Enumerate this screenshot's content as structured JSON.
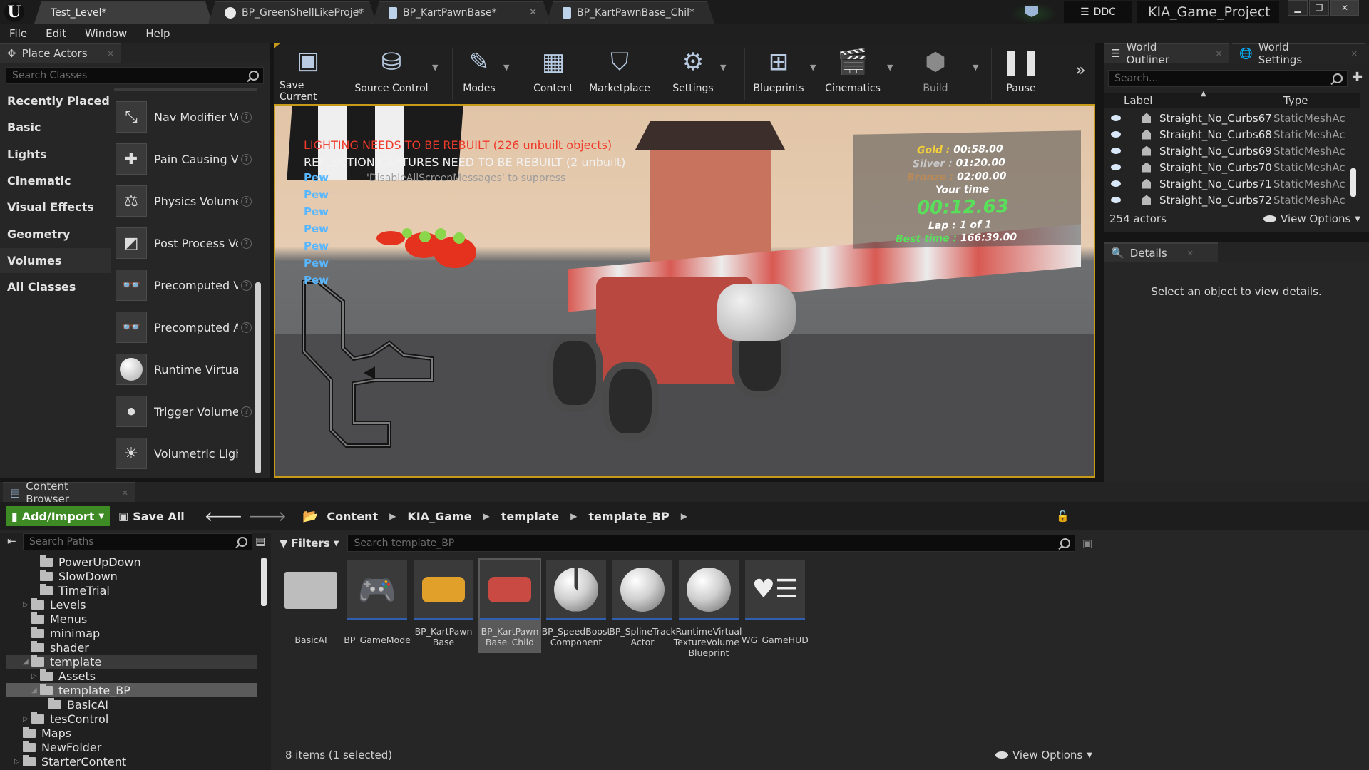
{
  "titlebar": {
    "tabs": [
      {
        "label": "Test_Level*"
      },
      {
        "label": "BP_GreenShellLikeProje*"
      },
      {
        "label": "BP_KartPawnBase*"
      },
      {
        "label": "BP_KartPawnBase_Chil*"
      }
    ],
    "ddc_label": "DDC",
    "project_name": "KIA_Game_Project"
  },
  "menubar": {
    "items": [
      "File",
      "Edit",
      "Window",
      "Help"
    ]
  },
  "place_actors": {
    "title": "Place Actors",
    "search_placeholder": "Search Classes",
    "categories": [
      "Recently Placed",
      "Basic",
      "Lights",
      "Cinematic",
      "Visual Effects",
      "Geometry",
      "Volumes",
      "All Classes"
    ],
    "selected_category": "Volumes",
    "items": [
      {
        "label": "Nav Modifier Volume",
        "icon": "nav-modifier-icon"
      },
      {
        "label": "Pain Causing Volume",
        "icon": "pain-causing-icon"
      },
      {
        "label": "Physics Volume",
        "icon": "physics-volume-icon"
      },
      {
        "label": "Post Process Volume",
        "icon": "post-process-icon"
      },
      {
        "label": "Precomputed Visibility Volume",
        "icon": "precomputed-icon"
      },
      {
        "label": "Precomputed AI",
        "icon": "precomputed-icon"
      },
      {
        "label": "Runtime Virtual Texture",
        "icon": "sphere-icon"
      },
      {
        "label": "Trigger Volume",
        "icon": "trigger-icon"
      },
      {
        "label": "Volumetric Lightmap",
        "icon": "sun-icon"
      }
    ]
  },
  "toolbar": {
    "buttons": [
      {
        "label": "Save Current",
        "icon": "save-icon"
      },
      {
        "label": "Source Control",
        "icon": "source-control-icon"
      },
      {
        "label": "Modes",
        "icon": "modes-icon"
      },
      {
        "label": "Content",
        "icon": "content-icon"
      },
      {
        "label": "Marketplace",
        "icon": "marketplace-icon"
      },
      {
        "label": "Settings",
        "icon": "gear-icon"
      },
      {
        "label": "Blueprints",
        "icon": "blueprints-icon"
      },
      {
        "label": "Cinematics",
        "icon": "clapper-icon"
      },
      {
        "label": "Build",
        "icon": "build-icon"
      },
      {
        "label": "Pause",
        "icon": "pause-icon"
      }
    ]
  },
  "viewport": {
    "messages": {
      "lighting": "LIGHTING NEEDS TO BE REBUILT (226 unbuilt objects)",
      "reflection": "REFLECTION CAPTURES NEED TO BE REBUILT (2 unbuilt)",
      "suppress": "'DisableAllScreenMessages' to suppress"
    },
    "pew_label": "Pew",
    "pew_count": 7,
    "hud": {
      "gold_label": "Gold :",
      "gold": "00:58.00",
      "silver_label": "Silver :",
      "silver": "01:20.00",
      "bronze_label": "Bronze :",
      "bronze": "02:00.00",
      "your_time_label": "Your time",
      "your_time": "00:12.63",
      "lap": "Lap  :  1 of 1",
      "best_label": "Best time  :",
      "best": "166:39.00"
    }
  },
  "outliner": {
    "tabs": [
      "World Outliner",
      "World Settings"
    ],
    "search_placeholder": "Search...",
    "columns": {
      "label": "Label",
      "type": "Type"
    },
    "rows": [
      {
        "label": "Straight_No_Curbs67",
        "type": "StaticMeshActor"
      },
      {
        "label": "Straight_No_Curbs68",
        "type": "StaticMeshActor"
      },
      {
        "label": "Straight_No_Curbs69",
        "type": "StaticMeshActor"
      },
      {
        "label": "Straight_No_Curbs70",
        "type": "StaticMeshActor"
      },
      {
        "label": "Straight_No_Curbs71",
        "type": "StaticMeshActor"
      },
      {
        "label": "Straight_No_Curbs72",
        "type": "StaticMeshActor"
      }
    ],
    "actor_count": "254 actors",
    "view_options": "View Options"
  },
  "details": {
    "title": "Details",
    "empty_text": "Select an object to view details."
  },
  "content_browser": {
    "title": "Content Browser",
    "add_import": "Add/Import",
    "save_all": "Save All",
    "breadcrumb": [
      "Content",
      "KIA_Game",
      "template",
      "template_BP"
    ],
    "search_paths_placeholder": "Search Paths",
    "filters_label": "Filters",
    "search_assets_placeholder": "Search template_BP",
    "tree": [
      {
        "label": "PowerUpDown",
        "indent": 3,
        "arrow": ""
      },
      {
        "label": "SlowDown",
        "indent": 3,
        "arrow": ""
      },
      {
        "label": "TimeTrial",
        "indent": 3,
        "arrow": ""
      },
      {
        "label": "Levels",
        "indent": 2,
        "arrow": "▷"
      },
      {
        "label": "Menus",
        "indent": 2,
        "arrow": ""
      },
      {
        "label": "minimap",
        "indent": 2,
        "arrow": ""
      },
      {
        "label": "shader",
        "indent": 2,
        "arrow": ""
      },
      {
        "label": "template",
        "indent": 2,
        "arrow": "◢"
      },
      {
        "label": "Assets",
        "indent": 3,
        "arrow": "▷"
      },
      {
        "label": "template_BP",
        "indent": 3,
        "arrow": "◢"
      },
      {
        "label": "BasicAI",
        "indent": 4,
        "arrow": ""
      },
      {
        "label": "tesControl",
        "indent": 2,
        "arrow": "▷"
      },
      {
        "label": "Maps",
        "indent": 1,
        "arrow": ""
      },
      {
        "label": "NewFolder",
        "indent": 1,
        "arrow": ""
      },
      {
        "label": "StarterContent",
        "indent": 1,
        "arrow": "▷"
      }
    ],
    "assets": [
      {
        "label": "BasicAI",
        "kind": "folder"
      },
      {
        "label": "BP_GameMode",
        "kind": "gamepad"
      },
      {
        "label": "BP_KartPawn\nBase",
        "kind": "kart"
      },
      {
        "label": "BP_KartPawn\nBase_Child",
        "kind": "kart2"
      },
      {
        "label": "BP_SpeedBoost\nComponent",
        "kind": "ball-split"
      },
      {
        "label": "BP_SplineTrack\nActor",
        "kind": "ball"
      },
      {
        "label": "RuntimeVirtual\nTextureVolume_\nBlueprint",
        "kind": "ball"
      },
      {
        "label": "WG_GameHUD",
        "kind": "hud"
      }
    ],
    "item_count": "8 items (1 selected)",
    "view_options": "View Options"
  },
  "colors": {
    "accent": "#c89a1a",
    "add_button": "#3e8a24",
    "selection_blue": "#2e5fb0"
  }
}
